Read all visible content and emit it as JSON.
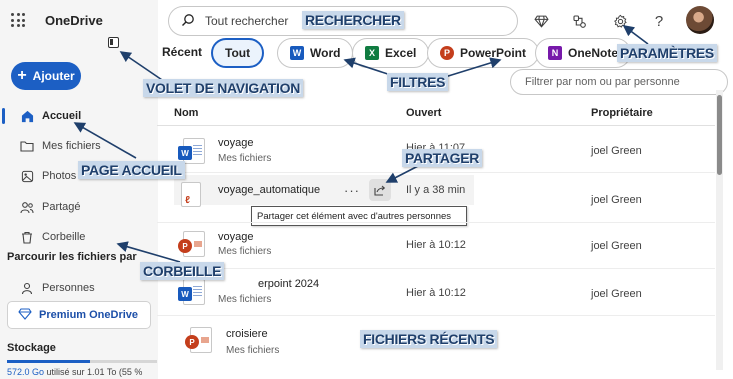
{
  "app": {
    "name": "OneDrive"
  },
  "sidebar": {
    "add_label": "Ajouter",
    "items": [
      {
        "label": "Accueil",
        "icon": "home-icon"
      },
      {
        "label": "Mes fichiers",
        "icon": "folder-icon"
      },
      {
        "label": "Photos",
        "icon": "photo-icon"
      },
      {
        "label": "Partagé",
        "icon": "people-icon"
      },
      {
        "label": "Corbeille",
        "icon": "trash-icon"
      }
    ],
    "browse_title": "Parcourir les fichiers par",
    "people_label": "Personnes",
    "premium_label": "Premium OneDrive",
    "storage_title": "Stockage",
    "storage_used": "572.0 Go",
    "storage_rest": " utilisé sur 1.01 To (55 %",
    "storage_fraction": 0.55
  },
  "search": {
    "placeholder": "Tout rechercher"
  },
  "filters": {
    "label": "Récent",
    "chips": [
      {
        "label": "Tout",
        "active": true
      },
      {
        "label": "Word",
        "logo": "W",
        "color": "#185abd"
      },
      {
        "label": "Excel",
        "logo": "X",
        "color": "#107c41"
      },
      {
        "label": "PowerPoint",
        "logo": "P",
        "color": "#c43e1c"
      },
      {
        "label": "OneNote",
        "logo": "N",
        "color": "#7719aa"
      }
    ],
    "name_filter_placeholder": "Filtrer par nom ou par personne"
  },
  "list": {
    "headers": {
      "name": "Nom",
      "opened": "Ouvert",
      "owner": "Propriétaire"
    },
    "rows": [
      {
        "name": "voyage",
        "location": "Mes fichiers",
        "opened": "Hier à 11:07",
        "owner": "joel Green",
        "type": "word"
      },
      {
        "name": "voyage_automatique",
        "location": "",
        "opened": "Il y a 38 min",
        "owner": "joel Green",
        "type": "pdf"
      },
      {
        "name": "voyage",
        "location": "Mes fichiers",
        "opened": "Hier à 10:12",
        "owner": "joel Green",
        "type": "powerpoint"
      },
      {
        "name": "erpoint 2024",
        "location": "Mes fichiers",
        "opened": "Hier à 10:12",
        "owner": "joel Green",
        "type": "word"
      },
      {
        "name": "croisiere",
        "location": "Mes fichiers",
        "opened": "",
        "owner": "",
        "type": "powerpoint"
      }
    ],
    "more_label": "···",
    "tooltip": "Partager cet élément avec d'autres personnes"
  },
  "callouts": {
    "search": "RECHERCHER",
    "settings": "PARAMÈTRES",
    "nav_pane": "VOLET DE NAVIGATION",
    "filters": "FILTRES",
    "home": "PAGE ACCUEIL",
    "share": "PARTAGER",
    "trash": "CORBEILLE",
    "recent_files": "FICHIERS RÉCENTS"
  },
  "colors": {
    "accent": "#1c5fc4",
    "callout_bg": "#c8d8ea",
    "callout_text": "#1f3f6b"
  }
}
